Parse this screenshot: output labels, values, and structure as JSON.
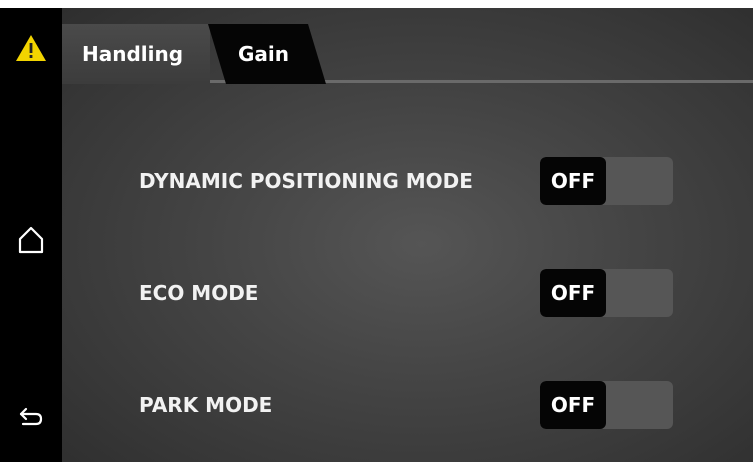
{
  "tabs": [
    {
      "label": "Handling"
    },
    {
      "label": "Gain"
    }
  ],
  "rows": [
    {
      "label": "DYNAMIC POSITIONING MODE",
      "toggle": "OFF"
    },
    {
      "label": "ECO MODE",
      "toggle": "OFF"
    },
    {
      "label": "PARK MODE",
      "toggle": "OFF"
    }
  ],
  "colors": {
    "warning": "#f2d400",
    "toggle_on": "#050505",
    "toggle_track": "#565656"
  },
  "icons": {
    "warning": "warning-triangle-icon",
    "home": "home-icon",
    "back": "back-arrow-icon"
  }
}
